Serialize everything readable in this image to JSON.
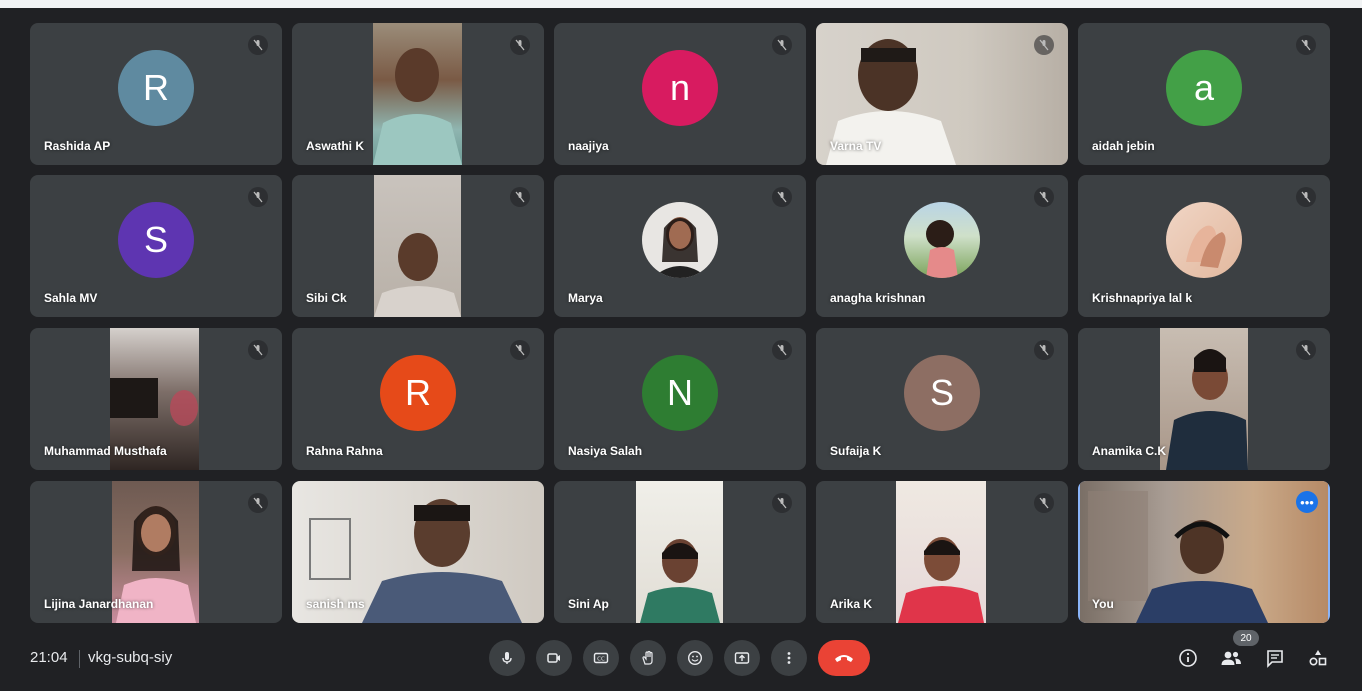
{
  "meeting": {
    "time": "21:04",
    "code": "vkg-subq-siy",
    "participant_count": "20"
  },
  "colors": {
    "background": "#202124",
    "tile": "#3c4043",
    "end_call": "#ea4335",
    "self_outline": "#8ab4f8"
  },
  "participants": [
    {
      "name": "Rashida AP",
      "initial": "R",
      "avatar_color": "#5f8aa0"
    },
    {
      "name": "Aswathi K"
    },
    {
      "name": "naajiya",
      "initial": "n",
      "avatar_color": "#d81b60"
    },
    {
      "name": "Varna TV"
    },
    {
      "name": "aidah jebin",
      "initial": "a",
      "avatar_color": "#43a047"
    },
    {
      "name": "Sahla MV",
      "initial": "S",
      "avatar_color": "#5e35b1"
    },
    {
      "name": "Sibi Ck"
    },
    {
      "name": "Marya"
    },
    {
      "name": "anagha krishnan"
    },
    {
      "name": "Krishnapriya lal k"
    },
    {
      "name": "Muhammad Musthafa"
    },
    {
      "name": "Rahna Rahna",
      "initial": "R",
      "avatar_color": "#e64a19"
    },
    {
      "name": "Nasiya Salah",
      "initial": "N",
      "avatar_color": "#2e7d32"
    },
    {
      "name": "Sufaija K",
      "initial": "S",
      "avatar_color": "#8d6e63"
    },
    {
      "name": "Anamika C.K"
    },
    {
      "name": "Lijina Janardhanan"
    },
    {
      "name": "sanish ms"
    },
    {
      "name": "Sini Ap"
    },
    {
      "name": "Arika K"
    },
    {
      "name": "You"
    }
  ],
  "controls": [
    {
      "name": "microphone-button",
      "icon": "microphone-icon"
    },
    {
      "name": "camera-button",
      "icon": "camera-icon"
    },
    {
      "name": "captions-button",
      "icon": "captions-icon"
    },
    {
      "name": "raise-hand-button",
      "icon": "hand-icon"
    },
    {
      "name": "reactions-button",
      "icon": "emoji-icon"
    },
    {
      "name": "present-button",
      "icon": "present-screen-icon"
    },
    {
      "name": "more-options-button",
      "icon": "more-vertical-icon"
    },
    {
      "name": "leave-call-button",
      "icon": "phone-hangup-icon"
    }
  ]
}
